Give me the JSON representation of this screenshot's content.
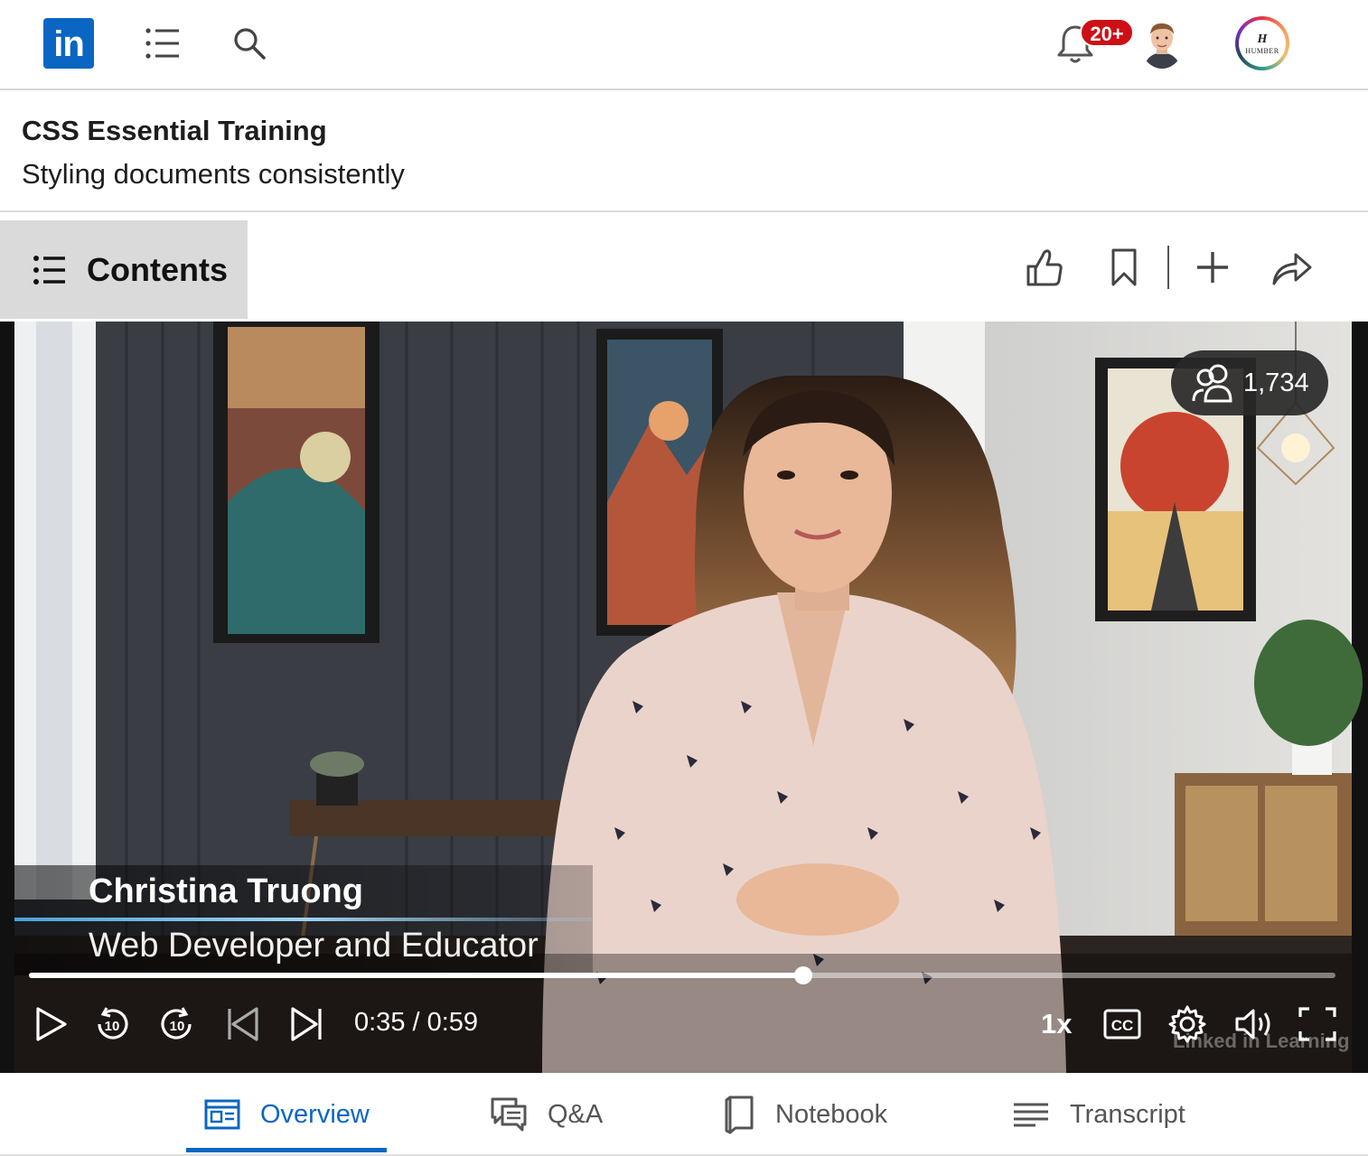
{
  "nav": {
    "logo_text": "in",
    "notification_badge": "20+"
  },
  "course": {
    "title": "CSS Essential Training",
    "chapter": "Styling documents consistently"
  },
  "toolbar": {
    "contents_label": "Contents"
  },
  "video": {
    "viewer_count": "1,734",
    "presenter_name": "Christina Truong",
    "presenter_role": "Web Developer and Educator",
    "current_time": "0:35",
    "duration": "0:59",
    "time_display": "0:35 / 0:59",
    "progress_fraction": 0.593,
    "speed": "1x",
    "watermark": "Linked in Learning"
  },
  "tabs": [
    {
      "label": "Overview",
      "icon": "overview-icon",
      "active": true
    },
    {
      "label": "Q&A",
      "icon": "qa-icon",
      "active": false
    },
    {
      "label": "Notebook",
      "icon": "notebook-icon",
      "active": false
    },
    {
      "label": "Transcript",
      "icon": "transcript-icon",
      "active": false
    }
  ],
  "colors": {
    "brand": "#0a66c2",
    "badge": "#cc1016"
  }
}
